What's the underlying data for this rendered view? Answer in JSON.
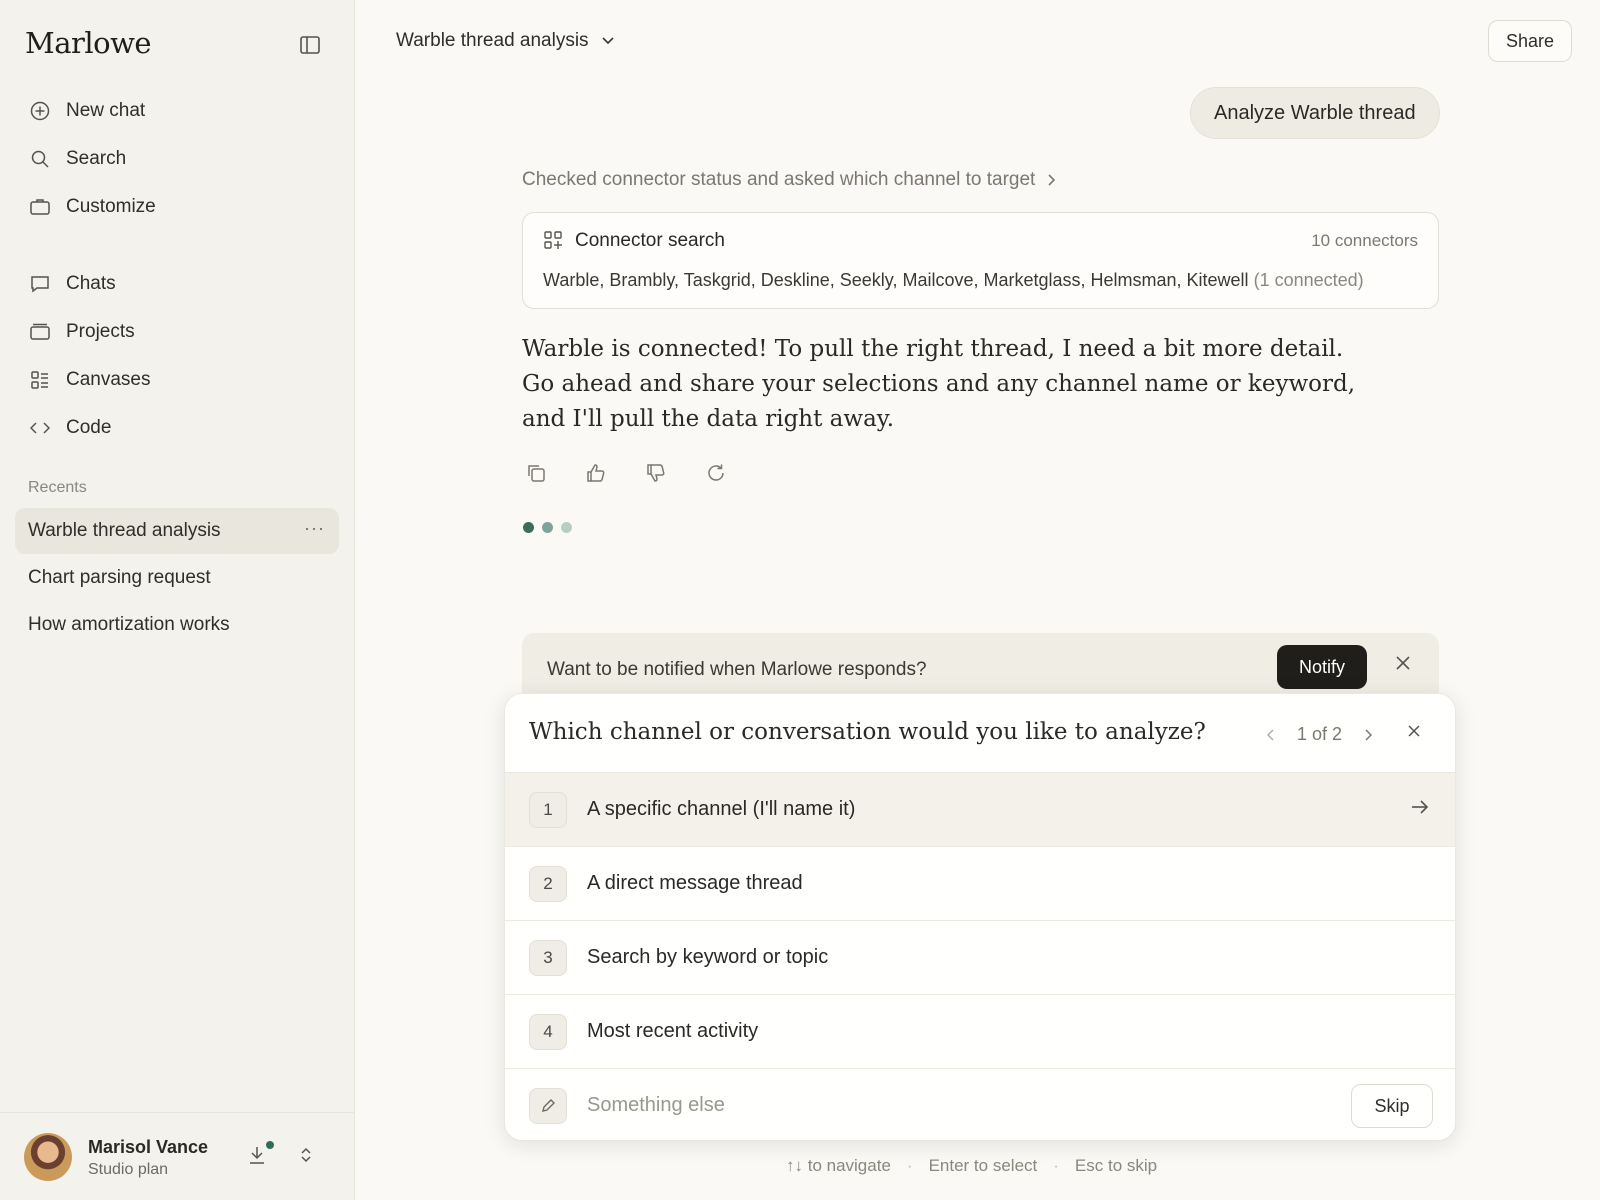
{
  "sidebar": {
    "brand": "Marlowe",
    "nav_top": [
      {
        "label": "New chat",
        "icon": "plus-circle-icon"
      },
      {
        "label": "Search",
        "icon": "search-icon"
      },
      {
        "label": "Customize",
        "icon": "briefcase-icon"
      }
    ],
    "nav_mid": [
      {
        "label": "Chats",
        "icon": "chat-bubble-icon"
      },
      {
        "label": "Projects",
        "icon": "folder-icon"
      },
      {
        "label": "Canvases",
        "icon": "canvas-icon"
      },
      {
        "label": "Code",
        "icon": "code-icon"
      }
    ],
    "recents_title": "Recents",
    "recents": [
      {
        "label": "Warble thread analysis",
        "active": true
      },
      {
        "label": "Chart parsing request",
        "active": false
      },
      {
        "label": "How amortization works",
        "active": false
      }
    ],
    "user": {
      "name": "Marisol Vance",
      "plan": "Studio plan"
    }
  },
  "header": {
    "title": "Warble thread analysis",
    "share_label": "Share"
  },
  "conversation": {
    "user_message": "Analyze Warble thread",
    "summary": "Checked connector status and asked which channel to target",
    "tool_card": {
      "title": "Connector search",
      "count": "10 connectors",
      "list": "Warble, Brambly, Taskgrid, Deskline, Seekly, Mailcove, Marketglass, Helmsman, Kitewell",
      "list_note": "(1 connected)"
    },
    "assistant_lines": [
      "Warble is connected! To pull the right thread, I need a bit more detail.",
      "Go ahead and share your selections and any channel name or keyword, and I'll pull the data right away."
    ]
  },
  "notify": {
    "text": "Want to be notified when Marlowe responds?",
    "button_label": "Notify"
  },
  "question": {
    "title": "Which channel or conversation would you like to analyze?",
    "pager": "1 of 2",
    "options": [
      {
        "num": "1",
        "label": "A specific channel (I'll name it)",
        "selected": true
      },
      {
        "num": "2",
        "label": "A direct message thread",
        "selected": false
      },
      {
        "num": "3",
        "label": "Search by keyword or topic",
        "selected": false
      },
      {
        "num": "4",
        "label": "Most recent activity",
        "selected": false
      }
    ],
    "other_placeholder": "Something else",
    "skip_label": "Skip"
  },
  "hints": {
    "navigate": "↑↓ to navigate",
    "select": "Enter to select",
    "skip": "Esc to skip"
  },
  "colors": {
    "accent_dark": "#1f1e1b",
    "status_dot": "#2f6d5a",
    "typing_dots": [
      "#3d6b60",
      "#7fa39a",
      "#b7cdc6"
    ]
  }
}
